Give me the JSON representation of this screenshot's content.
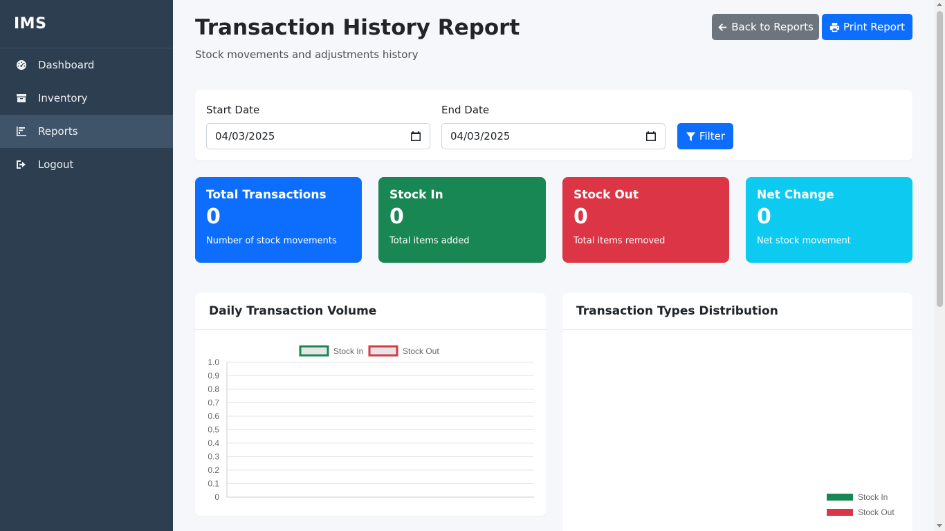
{
  "sidebar": {
    "brand": "IMS",
    "items": [
      {
        "label": "Dashboard",
        "icon": "dashboard-gauge-icon"
      },
      {
        "label": "Inventory",
        "icon": "box-icon"
      },
      {
        "label": "Reports",
        "icon": "bar-chart-icon",
        "active": true
      },
      {
        "label": "Logout",
        "icon": "sign-out-icon"
      }
    ]
  },
  "header": {
    "title": "Transaction History Report",
    "subtitle": "Stock movements and adjustments history",
    "back_label": "Back to Reports",
    "print_label": "Print Report"
  },
  "filter": {
    "start_label": "Start Date",
    "start_value": "04/03/2025",
    "end_label": "End Date",
    "end_value": "04/03/2025",
    "button_label": "Filter"
  },
  "stats": [
    {
      "title": "Total Transactions",
      "value": "0",
      "desc": "Number of stock movements",
      "color": "#0d6efd"
    },
    {
      "title": "Stock In",
      "value": "0",
      "desc": "Total items added",
      "color": "#198754"
    },
    {
      "title": "Stock Out",
      "value": "0",
      "desc": "Total items removed",
      "color": "#dc3545"
    },
    {
      "title": "Net Change",
      "value": "0",
      "desc": "Net stock movement",
      "color": "#0dcaf0"
    }
  ],
  "charts": {
    "daily_title": "Daily Transaction Volume",
    "types_title": "Transaction Types Distribution"
  },
  "chart_data": [
    {
      "type": "bar",
      "title": "Daily Transaction Volume",
      "categories": [],
      "series": [
        {
          "name": "Stock In",
          "values": [],
          "color": "#198754"
        },
        {
          "name": "Stock Out",
          "values": [],
          "color": "#dc3545"
        }
      ],
      "ylim": [
        0,
        1.0
      ],
      "yticks": [
        "1.0",
        "0.9",
        "0.8",
        "0.7",
        "0.6",
        "0.5",
        "0.4",
        "0.3",
        "0.2",
        "0.1",
        "0"
      ],
      "legend": "top",
      "grid": true
    },
    {
      "type": "pie",
      "title": "Transaction Types Distribution",
      "categories": [
        "Stock In",
        "Stock Out"
      ],
      "values": [],
      "colors": [
        "#198754",
        "#dc3545"
      ],
      "legend": "bottom-right"
    }
  ]
}
